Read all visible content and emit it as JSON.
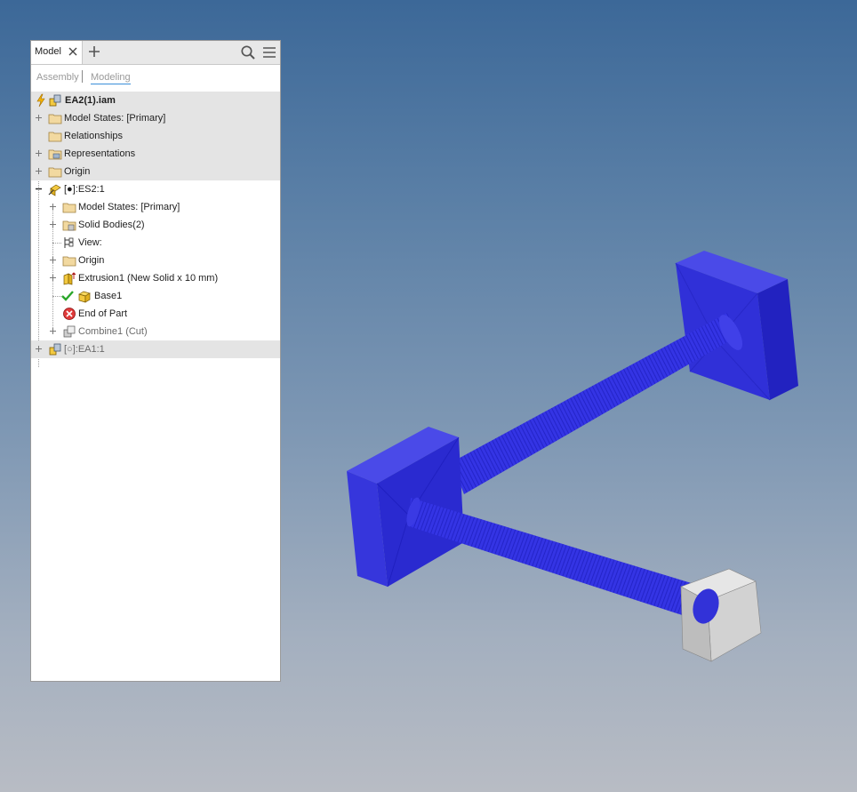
{
  "panel": {
    "tabs": [
      {
        "label": "Model",
        "close_icon": "close-icon"
      },
      {
        "add_icon": "plus-icon"
      }
    ],
    "toolbar": {
      "search_icon": "search-icon",
      "menu_icon": "hamburger-menu-icon"
    },
    "subtabs": {
      "assembly": "Assembly",
      "modeling": "Modeling",
      "active": "Modeling"
    },
    "tree": [
      {
        "label": "EA2(1).iam",
        "level": 0,
        "icon": "assembly-icon",
        "expander": "none"
      },
      {
        "label": "Model States: [Primary]",
        "level": 0,
        "icon": "folder-icon",
        "expander": "plus"
      },
      {
        "label": "Relationships",
        "level": 0,
        "icon": "folder-icon",
        "expander": "none"
      },
      {
        "label": "Representations",
        "level": 0,
        "icon": "representations-icon",
        "expander": "plus"
      },
      {
        "label": "Origin",
        "level": 0,
        "icon": "folder-icon",
        "expander": "plus"
      },
      {
        "label": "[●]:ES2:1",
        "level": 0,
        "icon": "part-edit-icon",
        "expander": "minus"
      },
      {
        "label": "Model States: [Primary]",
        "level": 1,
        "icon": "folder-icon",
        "expander": "plus"
      },
      {
        "label": "Solid Bodies(2)",
        "level": 1,
        "icon": "solid-bodies-icon",
        "expander": "plus"
      },
      {
        "label": "View:",
        "level": 1,
        "icon": "view-icon",
        "expander": "none"
      },
      {
        "label": "Origin",
        "level": 1,
        "icon": "folder-icon",
        "expander": "plus"
      },
      {
        "label": "Extrusion1 (New Solid x 10 mm)",
        "level": 1,
        "icon": "extrusion-icon",
        "expander": "plus"
      },
      {
        "label": "Base1",
        "level": 1,
        "icon": "base-part-icon",
        "expander": "none"
      },
      {
        "label": "End of Part",
        "level": 1,
        "icon": "end-of-part-icon",
        "expander": "none"
      },
      {
        "label": "Combine1 (Cut)",
        "level": 1,
        "icon": "combine-icon",
        "expander": "plus"
      },
      {
        "label": "[○]:EA1:1",
        "level": 0,
        "icon": "assembly-part-icon",
        "expander": "plus"
      }
    ]
  },
  "viewport": {
    "model_color": "#3a3ae0",
    "highlight_part_color": "#d8d8d8",
    "background_top": "#3c6898",
    "background_bottom": "#b8bcc4"
  }
}
